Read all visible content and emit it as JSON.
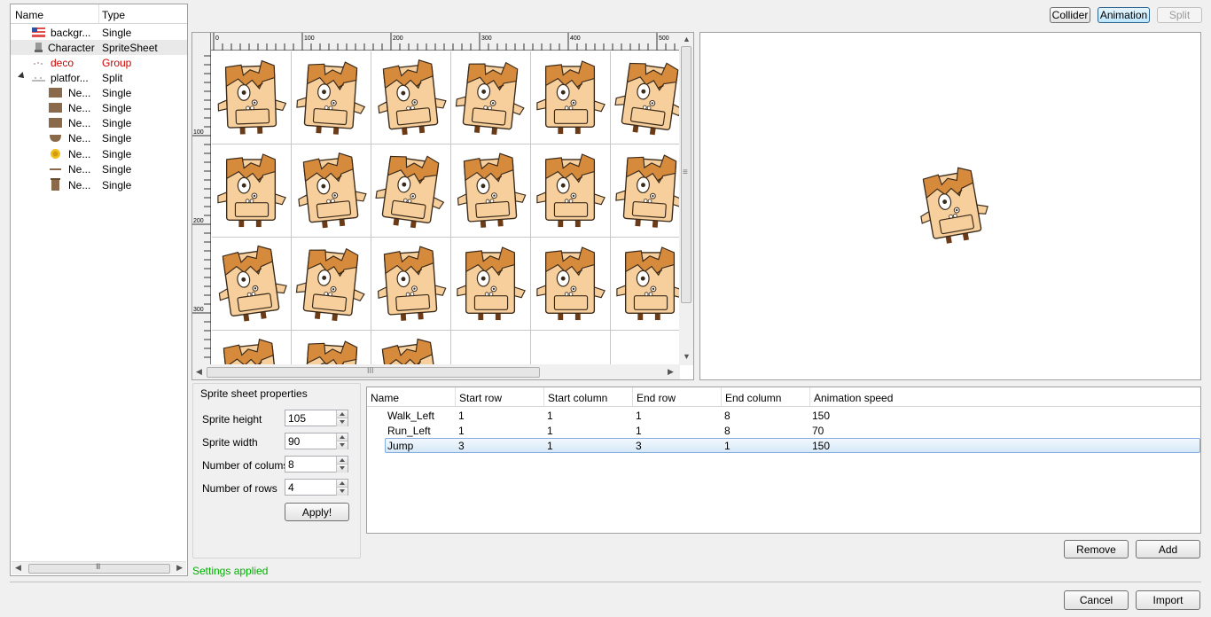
{
  "tree": {
    "columns": {
      "name": "Name",
      "type": "Type"
    },
    "items": [
      {
        "name": "backgr...",
        "type": "Single",
        "icon": "flag-icon"
      },
      {
        "name": "Character",
        "type": "SpriteSheet",
        "icon": "character-icon"
      },
      {
        "name": "deco",
        "type": "Group",
        "icon": "deco-icon"
      },
      {
        "name": "platfor...",
        "type": "Split",
        "icon": "platform-icon"
      },
      {
        "name": "Ne...",
        "type": "Single",
        "icon": "brick-icon"
      },
      {
        "name": "Ne...",
        "type": "Single",
        "icon": "brick-icon"
      },
      {
        "name": "Ne...",
        "type": "Single",
        "icon": "brick-icon"
      },
      {
        "name": "Ne...",
        "type": "Single",
        "icon": "half-round-icon"
      },
      {
        "name": "Ne...",
        "type": "Single",
        "icon": "coin-icon"
      },
      {
        "name": "Ne...",
        "type": "Single",
        "icon": "line-icon"
      },
      {
        "name": "Ne...",
        "type": "Single",
        "icon": "pillar-icon"
      }
    ],
    "scroll_grip": "III"
  },
  "toolbar": {
    "collider_label": "Collider",
    "animation_label": "Animation",
    "split_label": "Split"
  },
  "ruler": {
    "top_labels": [
      "0",
      "100",
      "200",
      "300",
      "400",
      "500"
    ],
    "left_labels": [
      "100",
      "200",
      "300"
    ]
  },
  "sheet": {
    "rows_visible": 4,
    "cols_visible": 6,
    "scroll_grip": "III",
    "vscroll_grip": "≡",
    "up_arrow": "▲",
    "down_arrow": "▼",
    "left_arrow": "◀",
    "right_arrow": "▶"
  },
  "properties": {
    "title": "Sprite sheet properties",
    "fields": [
      {
        "label": "Sprite height",
        "value": "105"
      },
      {
        "label": "Sprite width",
        "value": "90"
      },
      {
        "label": "Number of colums",
        "value": "8"
      },
      {
        "label": "Number of rows",
        "value": "4"
      }
    ],
    "apply_label": "Apply!"
  },
  "animations": {
    "columns": [
      "Name",
      "Start row",
      "Start column",
      "End row",
      "End column",
      "Animation speed"
    ],
    "rows": [
      {
        "name": "Walk_Left",
        "start_row": "1",
        "start_col": "1",
        "end_row": "1",
        "end_col": "8",
        "speed": "150"
      },
      {
        "name": "Run_Left",
        "start_row": "1",
        "start_col": "1",
        "end_row": "1",
        "end_col": "8",
        "speed": "70"
      },
      {
        "name": "Jump",
        "start_row": "3",
        "start_col": "1",
        "end_row": "3",
        "end_col": "1",
        "speed": "150"
      }
    ],
    "selected_index": 2
  },
  "actions": {
    "remove_label": "Remove",
    "add_label": "Add",
    "cancel_label": "Cancel",
    "import_label": "Import"
  },
  "status": {
    "text": "Settings applied"
  },
  "colors": {
    "status_green": "#00b000",
    "group_red": "#cc0000",
    "character_skin": "#f6cf9c",
    "character_hair": "#d68a3c",
    "character_outline": "#3a2a1a"
  }
}
